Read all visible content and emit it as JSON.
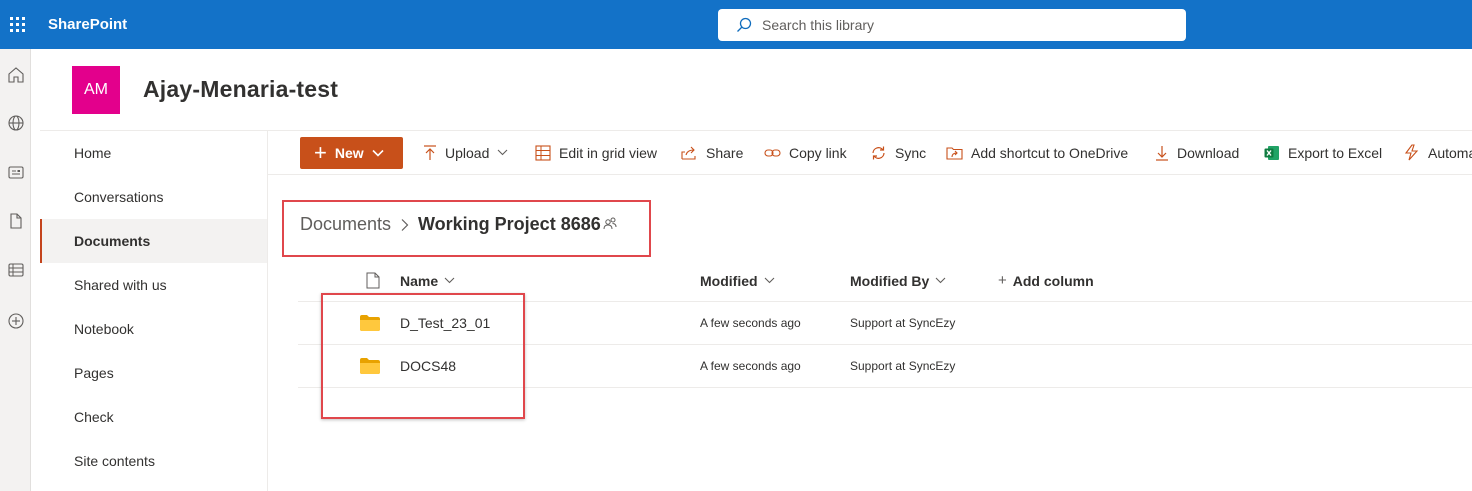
{
  "suite": {
    "brand": "SharePoint",
    "search_placeholder": "Search this library"
  },
  "site": {
    "logo_initials": "AM",
    "logo_color": "#e3008c",
    "title": "Ajay-Menaria-test"
  },
  "rail": {
    "icons": [
      "home-icon",
      "globe-icon",
      "news-icon",
      "file-icon",
      "list-icon",
      "add-circle-icon"
    ]
  },
  "nav": {
    "items": [
      {
        "label": "Home"
      },
      {
        "label": "Conversations"
      },
      {
        "label": "Documents",
        "active": true
      },
      {
        "label": "Shared with us"
      },
      {
        "label": "Notebook"
      },
      {
        "label": "Pages"
      },
      {
        "label": "Check"
      },
      {
        "label": "Site contents"
      }
    ]
  },
  "commands": {
    "new": "New",
    "upload": "Upload",
    "edit_grid": "Edit in grid view",
    "share": "Share",
    "copy_link": "Copy link",
    "sync": "Sync",
    "add_shortcut": "Add shortcut to OneDrive",
    "download": "Download",
    "export_excel": "Export to Excel",
    "automate": "Automate",
    "accent_color": "#c8501a"
  },
  "breadcrumb": {
    "root": "Documents",
    "current": "Working Project 8686"
  },
  "list": {
    "columns": {
      "name": "Name",
      "modified": "Modified",
      "modified_by": "Modified By",
      "add_column": "Add column"
    },
    "rows": [
      {
        "name": "D_Test_23_01",
        "modified": "A few seconds ago",
        "modified_by": "Support at SyncEzy"
      },
      {
        "name": "DOCS48",
        "modified": "A few seconds ago",
        "modified_by": "Support at SyncEzy"
      }
    ]
  },
  "colors": {
    "suite_bar": "#1372c8",
    "highlight_box": "#e0474c",
    "folder": "#ffb900"
  }
}
